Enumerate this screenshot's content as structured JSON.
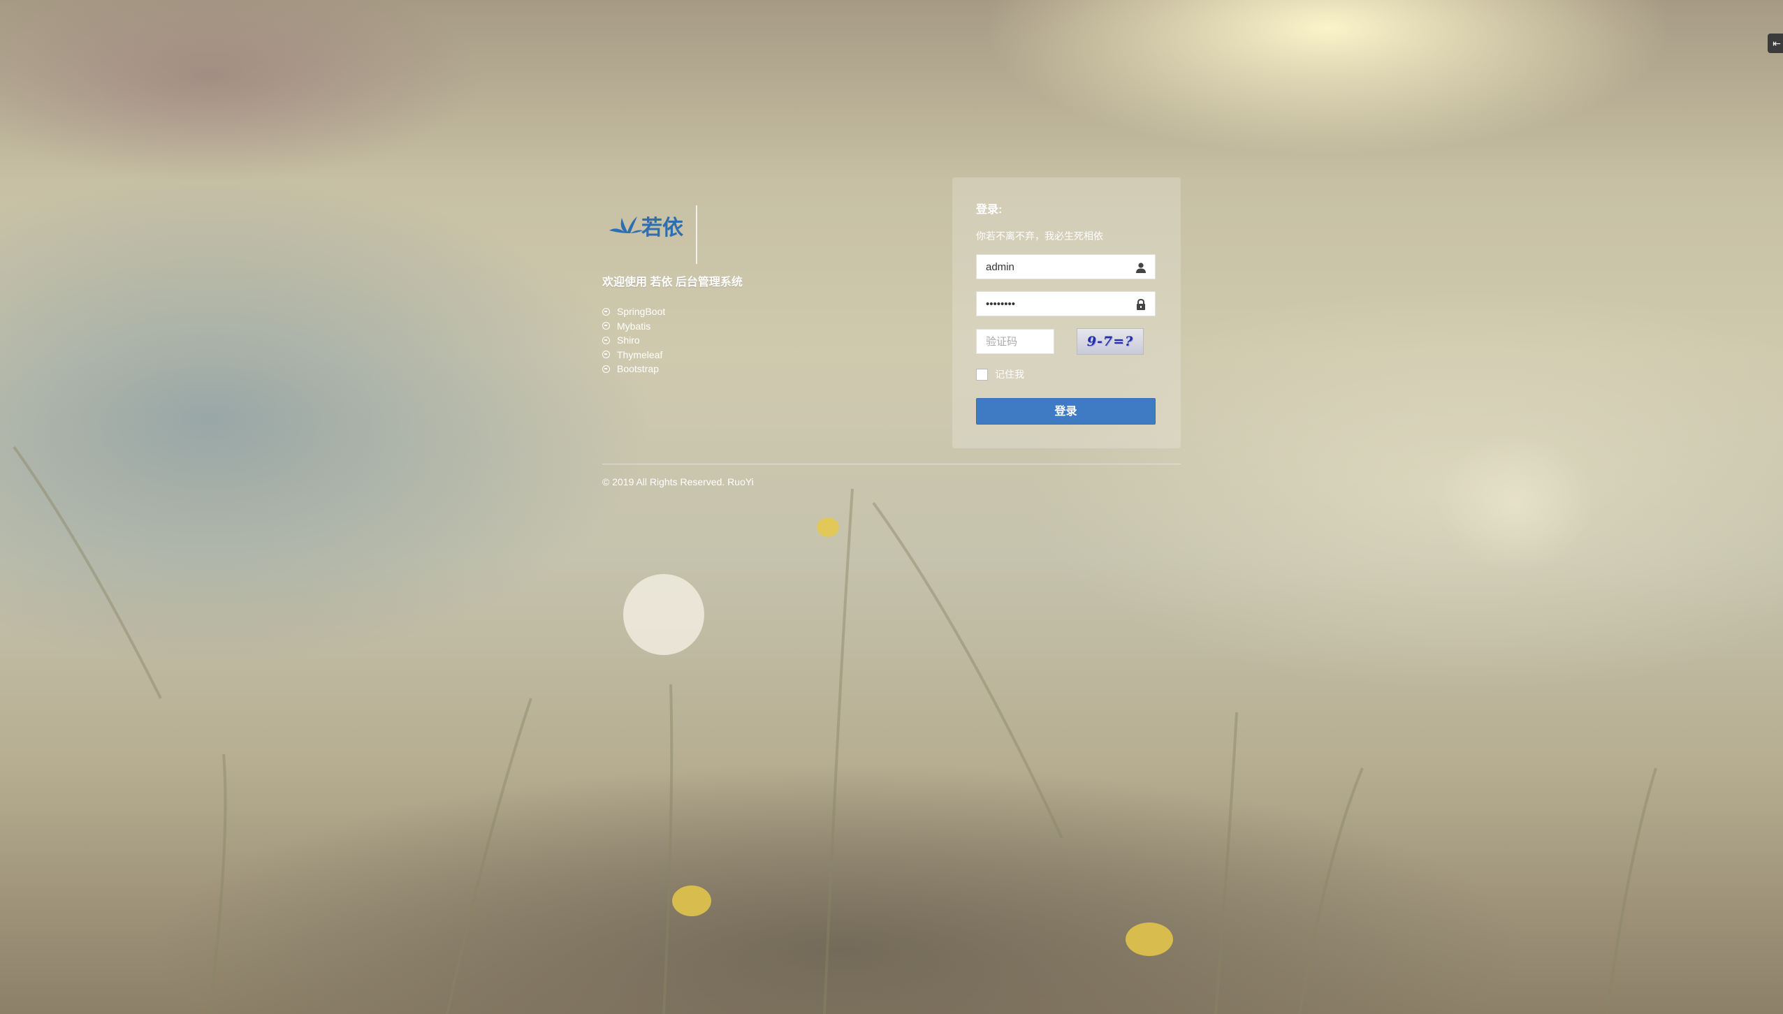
{
  "brand": {
    "logo_text": "若依",
    "welcome": "欢迎使用 若依 后台管理系统",
    "features": [
      "SpringBoot",
      "Mybatis",
      "Shiro",
      "Thymeleaf",
      "Bootstrap"
    ]
  },
  "login": {
    "title": "登录:",
    "subtitle": "你若不离不弃，我必生死相依",
    "username_value": "admin",
    "password_value": "••••••••",
    "captcha_placeholder": "验证码",
    "captcha_text": "9-7=?",
    "remember_label": "记住我",
    "submit_label": "登录"
  },
  "footer": {
    "copyright": "© 2019 All Rights Reserved. RuoYi"
  },
  "icons": {
    "user": "user-icon",
    "lock": "lock-icon",
    "bullet": "minus-circle-icon",
    "corner": "collapse-icon"
  },
  "colors": {
    "button": "#3f7bc4",
    "logo": "#2f6fb0"
  }
}
